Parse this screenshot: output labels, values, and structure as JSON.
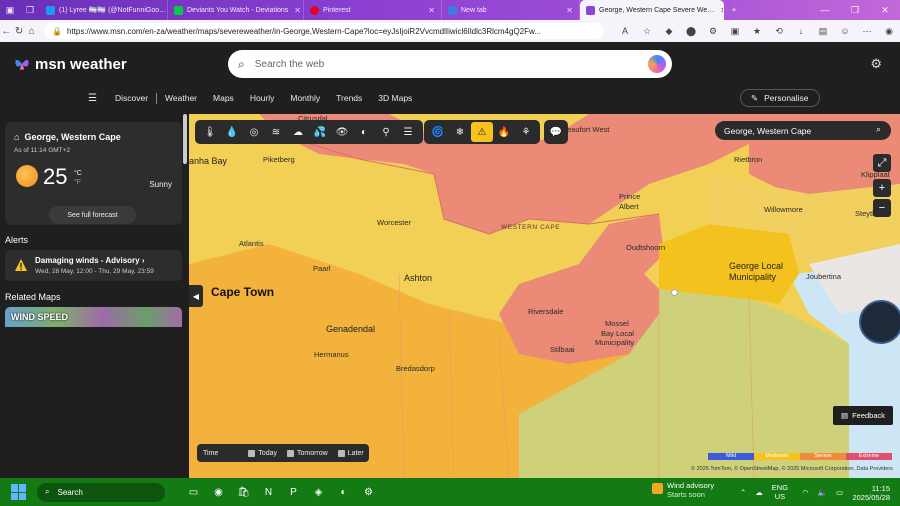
{
  "browser": {
    "tabs": [
      {
        "title": "(1) Lyree 🏳️‍⚧️🏳️‍⚧️ (@NotFunniGoo…",
        "color": "#1d9bf0"
      },
      {
        "title": "Deviants You Watch - Deviations",
        "color": "#05cc47"
      },
      {
        "title": "Pinterest",
        "color": "#e60023"
      },
      {
        "title": "New tab",
        "color": "#3c7be0"
      },
      {
        "title": "George, Western Cape Severe We…",
        "color": "#8a44d8"
      }
    ],
    "url": "https://www.msn.com/en-za/weather/maps/severeweather/in-George,Western-Cape?loc=eyJsIjoiR2VvcmdlIiwicl6Ildlc3Rlcm4gQ2Fw..."
  },
  "header": {
    "logo": "msn weather",
    "search_placeholder": "Search the web"
  },
  "nav": {
    "items": [
      "Discover",
      "Weather",
      "Maps",
      "Hourly",
      "Monthly",
      "Trends",
      "3D Maps"
    ],
    "personalise": "Personalise"
  },
  "current": {
    "location": "George, Western Cape",
    "as_of": "As of 11:14 GMT+2",
    "temp": "25",
    "unit_c": "°C",
    "unit_f": "°F",
    "condition": "Sunny",
    "full_forecast": "See full forecast"
  },
  "alerts": {
    "heading": "Alerts",
    "title": "Damaging winds - Advisory",
    "time": "Wed, 28 May, 12:00 - Thu, 29 May, 23:59"
  },
  "related": {
    "heading": "Related Maps",
    "map_label": "WIND SPEED"
  },
  "map": {
    "search_value": "George, Western Cape",
    "region_label": "WESTERN CAPE",
    "cities": [
      {
        "name": "Citrusdal",
        "cls": "city",
        "pos": "ct"
      },
      {
        "name": "Beaufort West",
        "cls": "city",
        "pos": "bw"
      },
      {
        "name": "anha Bay",
        "cls": "city med",
        "pos": "sb"
      },
      {
        "name": "Piketberg",
        "cls": "city",
        "pos": "pk"
      },
      {
        "name": "Rietbron",
        "cls": "city",
        "pos": "rb"
      },
      {
        "name": "Klipplaat",
        "cls": "city",
        "pos": "kl"
      },
      {
        "name": "Prince",
        "cls": "city",
        "pos": "pa1"
      },
      {
        "name": "Albert",
        "cls": "city",
        "pos": "pa2"
      },
      {
        "name": "Willowmore",
        "cls": "city",
        "pos": "wm"
      },
      {
        "name": "Steytle",
        "cls": "city",
        "pos": "st"
      },
      {
        "name": "Worcester",
        "cls": "city",
        "pos": "wo"
      },
      {
        "name": "Atlantis",
        "cls": "city",
        "pos": "at"
      },
      {
        "name": "Oudtshoorn",
        "cls": "city",
        "pos": "ou"
      },
      {
        "name": "George Local",
        "cls": "city med",
        "pos": "gl1"
      },
      {
        "name": "Municipality",
        "cls": "city med",
        "pos": "gl2"
      },
      {
        "name": "Joubertina",
        "cls": "city",
        "pos": "jb"
      },
      {
        "name": "Paarl",
        "cls": "city",
        "pos": "pl"
      },
      {
        "name": "Ashton",
        "cls": "city med",
        "pos": "as"
      },
      {
        "name": "Cape Town",
        "cls": "city big",
        "pos": "cp"
      },
      {
        "name": "Riversdale",
        "cls": "city",
        "pos": "rv"
      },
      {
        "name": "Mossel",
        "cls": "city",
        "pos": "mb1"
      },
      {
        "name": "Bay Local",
        "cls": "city",
        "pos": "mb2"
      },
      {
        "name": "Municipality",
        "cls": "city",
        "pos": "mb3"
      },
      {
        "name": "Genadendal",
        "cls": "city med",
        "pos": "gd"
      },
      {
        "name": "Stilbaai",
        "cls": "city",
        "pos": "sb2"
      },
      {
        "name": "Hermanus",
        "cls": "city",
        "pos": "hm"
      },
      {
        "name": "Bredasdorp",
        "cls": "city",
        "pos": "bd"
      }
    ],
    "timebar": {
      "label": "Time",
      "options": [
        "Today",
        "Tomorrow",
        "Later"
      ]
    },
    "feedback": "Feedback",
    "legend": [
      {
        "label": "Mild",
        "color": "#3b5bdb"
      },
      {
        "label": "Moderate",
        "color": "#f6c21c"
      },
      {
        "label": "Severe",
        "color": "#f08a3c"
      },
      {
        "label": "Extreme",
        "color": "#e0506e"
      }
    ],
    "attribution": "© 2025 TomTom, © OpenStreetMap, © 2025 Microsoft Corporation, Data Providers"
  },
  "taskbar": {
    "search": "Search",
    "weather_title": "Wind advisory",
    "weather_sub": "Starts soon",
    "lang1": "ENG",
    "lang2": "US",
    "time": "11:15",
    "date": "2025/05/28"
  }
}
